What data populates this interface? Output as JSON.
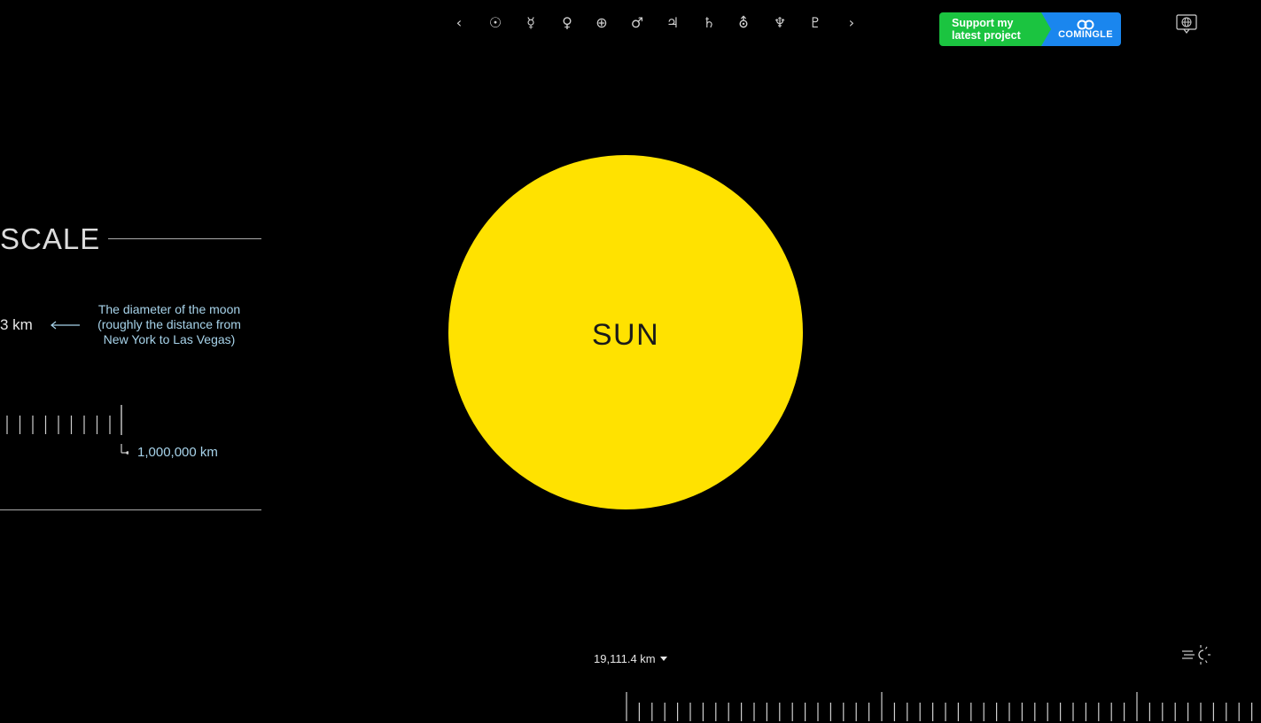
{
  "nav": {
    "prev_glyph": "‹",
    "next_glyph": "›",
    "bodies": [
      {
        "name": "sun",
        "glyph": "☉"
      },
      {
        "name": "mercury",
        "glyph": "☿"
      },
      {
        "name": "venus",
        "glyph": "♀"
      },
      {
        "name": "earth",
        "glyph": "⊕"
      },
      {
        "name": "mars",
        "glyph": "♂"
      },
      {
        "name": "jupiter",
        "glyph": "♃"
      },
      {
        "name": "saturn",
        "glyph": "♄"
      },
      {
        "name": "uranus",
        "glyph": "⛢"
      },
      {
        "name": "neptune",
        "glyph": "♆"
      },
      {
        "name": "pluto",
        "glyph": "♇"
      }
    ]
  },
  "promo": {
    "line1": "Support my",
    "line2": "latest project",
    "brand": "COMINGLE",
    "green": "#1bc440",
    "blue": "#1a86ee"
  },
  "language_icon": "globe-chat-icon",
  "scale_panel": {
    "title": "SCALE",
    "moon_value": "3 km",
    "moon_description": "The diameter of the moon (roughly the distance from New York to Las Vegas)",
    "ruler_label": "1,000,000 km"
  },
  "body": {
    "label": "SUN",
    "color": "#ffe200"
  },
  "footer": {
    "viewport_width": "19,111.4 km",
    "light_icon": "sun-light-icon"
  },
  "colors": {
    "background": "#000000",
    "accent_text": "#a7d3ea"
  }
}
